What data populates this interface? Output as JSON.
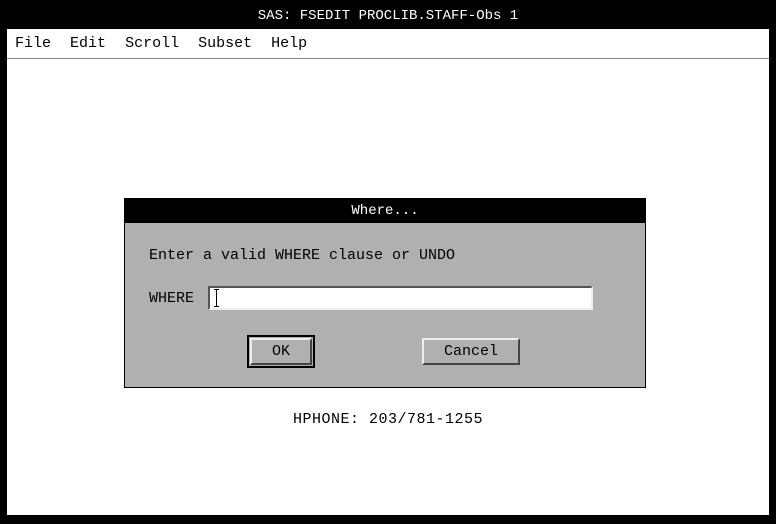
{
  "window": {
    "title": "SAS: FSEDIT PROCLIB.STAFF-Obs 1"
  },
  "menu": {
    "items": [
      "File",
      "Edit",
      "Scroll",
      "Subset",
      "Help"
    ]
  },
  "background": {
    "hphone_line": "HPHONE: 203/781-1255"
  },
  "dialog": {
    "title": "Where...",
    "prompt": "Enter a valid WHERE clause or UNDO",
    "field_label": "WHERE",
    "field_value": "",
    "ok_label": "OK",
    "cancel_label": "Cancel"
  }
}
